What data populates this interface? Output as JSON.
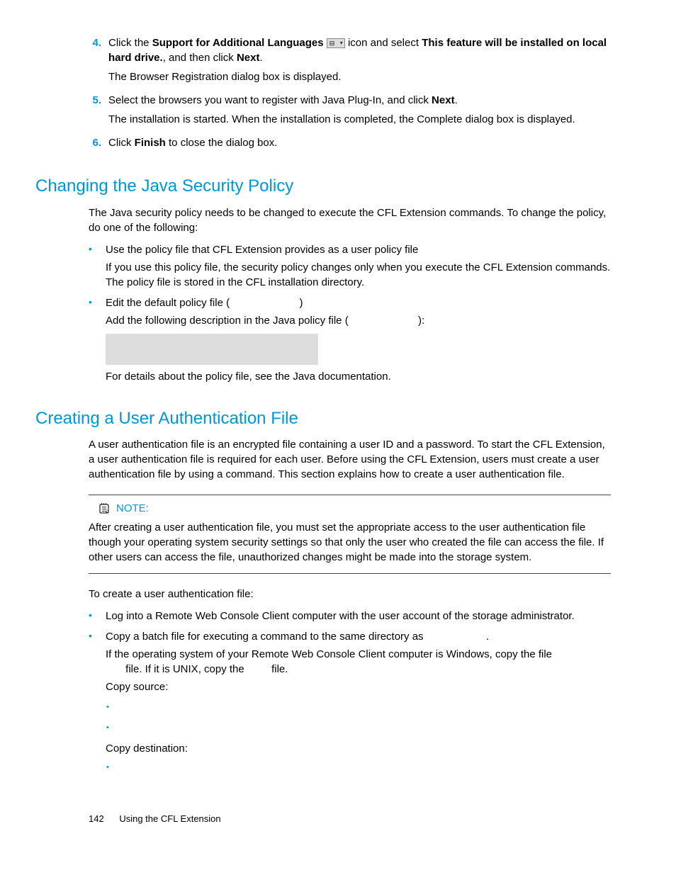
{
  "steps": {
    "s4": {
      "num": "4.",
      "t1": "Click the ",
      "b1": "Support for Additional Languages",
      "t2": " icon and select ",
      "b2": "This feature will be installed on local hard drive.",
      "t3": ", and then click ",
      "b3": "Next",
      "t4": ".",
      "p2": "The Browser Registration dialog box is displayed."
    },
    "s5": {
      "num": "5.",
      "t1": "Select the browsers you want to register with Java Plug-In, and click ",
      "b1": "Next",
      "t2": ".",
      "p2": "The installation is started. When the installation is completed, the Complete dialog box is displayed."
    },
    "s6": {
      "num": "6.",
      "t1": "Click ",
      "b1": "Finish",
      "t2": " to close the dialog box."
    }
  },
  "h2a": "Changing the Java Security Policy",
  "sec1": {
    "intro": "The Java security policy needs to be changed to execute the CFL Extension commands. To change the policy, do one of the following:",
    "b1": {
      "l1": "Use the policy file that CFL Extension provides as a user policy file",
      "l2": "If you use this policy file, the security policy changes only when you execute the CFL Extension commands. The policy file is stored in the CFL installation directory."
    },
    "b2": {
      "l1a": "Edit the default policy file (",
      "l1b": ")",
      "l2a": "Add the following description in the Java policy file (",
      "l2b": "):",
      "l3": "For details about the policy file, see the Java documentation."
    }
  },
  "h2b": "Creating a User Authentication File",
  "sec2": {
    "intro": "A user authentication file is an encrypted file containing a user ID and a password. To start the CFL Extension, a user authentication file is required for each user. Before using the CFL Extension, users must create a user authentication file by using a command. This section explains how to create a user authentication file.",
    "noteLabel": "NOTE:",
    "noteBody": "After creating a user authentication file, you must set the appropriate access to the user authentication file though your operating system security settings so that only the user who created the file can access the file. If other users can access the file, unauthorized changes might be made into the storage system.",
    "lead": "To create a user authentication file:",
    "b1": "Log into a Remote Web Console Client computer with the user account of the storage administrator.",
    "b2": {
      "l1a": "Copy a batch file for executing a command to the same directory as ",
      "l1b": ".",
      "l2a": "If the operating system of your Remote Web Console Client computer is Windows, copy the file ",
      "l2b": " file. If it is UNIX, copy the ",
      "l2c": " file.",
      "src": "Copy source:",
      "dst": "Copy destination:"
    }
  },
  "footer": {
    "page": "142",
    "title": "Using the CFL Extension"
  }
}
